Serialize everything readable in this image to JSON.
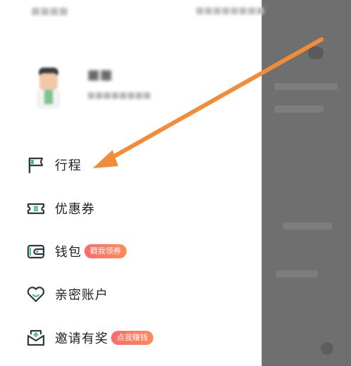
{
  "colors": {
    "icon_dark": "#2f3a3f",
    "icon_accent": "#3dbf8b",
    "badge_start": "#ff6a6a",
    "badge_end": "#ff8a5a",
    "annotation_arrow": "#f28c38",
    "overlay": "#6f6f6f"
  },
  "menu": {
    "items": [
      {
        "label": "行程",
        "icon": "flag-icon"
      },
      {
        "label": "优惠券",
        "icon": "coupon-icon"
      },
      {
        "label": "钱包",
        "icon": "wallet-icon",
        "badge": "戳我领券"
      },
      {
        "label": "亲密账户",
        "icon": "heart-icon"
      },
      {
        "label": "邀请有奖",
        "icon": "invite-gift-icon",
        "badge": "点我赚钱"
      }
    ]
  }
}
